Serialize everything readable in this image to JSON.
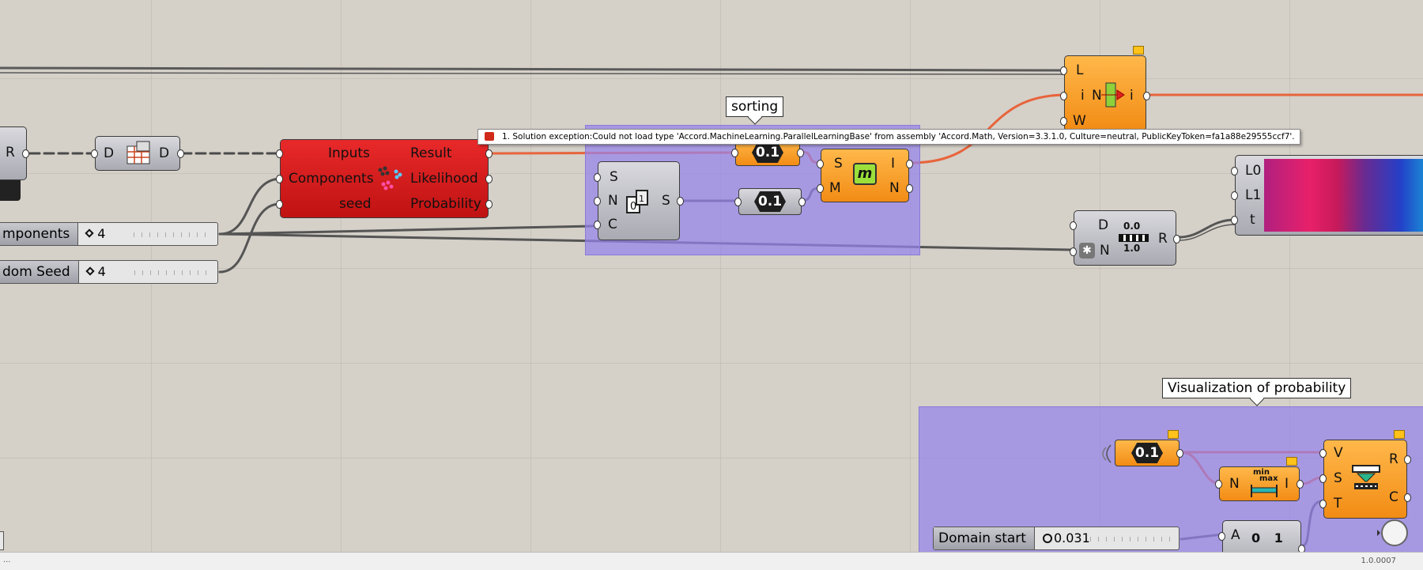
{
  "tooltip": {
    "text": "1. Solution exception:Could not load type 'Accord.MachineLearning.ParallelLearningBase' from assembly 'Accord.Math, Version=3.3.1.0, Culture=neutral, PublicKeyToken=fa1a88e29555ccf7'."
  },
  "notes": {
    "sorting": "sorting",
    "visualization": "Visualization of probability"
  },
  "sliders": {
    "components": {
      "name": "mponents",
      "value": "4"
    },
    "seed": {
      "name": "dom Seed",
      "value": "4"
    },
    "domain_start": {
      "name": "Domain start",
      "value": "0.031"
    }
  },
  "edge_param": {
    "output": "R"
  },
  "dataset_comp": {
    "input": "D",
    "output": "D"
  },
  "gmm": {
    "inputs": [
      "Inputs",
      "Components",
      "seed"
    ],
    "outputs": [
      "Result",
      "Likelihood",
      "Probability"
    ]
  },
  "sort": {
    "inputs": [
      "S",
      "N",
      "C"
    ],
    "output": "S"
  },
  "num1": {
    "label": "0.1"
  },
  "num2": {
    "label": "0.1"
  },
  "num3": {
    "label": "0.1"
  },
  "member": {
    "inputs": [
      "S",
      "M"
    ],
    "outputs": [
      "I",
      "N"
    ],
    "icon_text": "m"
  },
  "listitem": {
    "inputs": [
      "L",
      "i",
      "W"
    ],
    "middle": "N",
    "output": "i"
  },
  "remap": {
    "inputs": [
      "D",
      "N"
    ],
    "output": "R",
    "top_text": "0.0",
    "bottom_text": "1.0"
  },
  "gradient": {
    "inputs": [
      "L0",
      "L1",
      "t"
    ]
  },
  "bounds": {
    "input": "N",
    "output": "I",
    "top": "min",
    "sub": "max"
  },
  "remap2": {
    "inputs": [
      "V",
      "S",
      "T"
    ],
    "outputs": [
      "R",
      "C"
    ]
  },
  "series": {
    "input": "A",
    "text": "0 1"
  },
  "status": {
    "version": "1.0.0007",
    "left": "..."
  },
  "colors": {
    "canvas": "#d5d0c8",
    "group": "#9682eb",
    "error": "#d01818",
    "warning": "#f5961c",
    "wire_selected": "#e8643c"
  }
}
